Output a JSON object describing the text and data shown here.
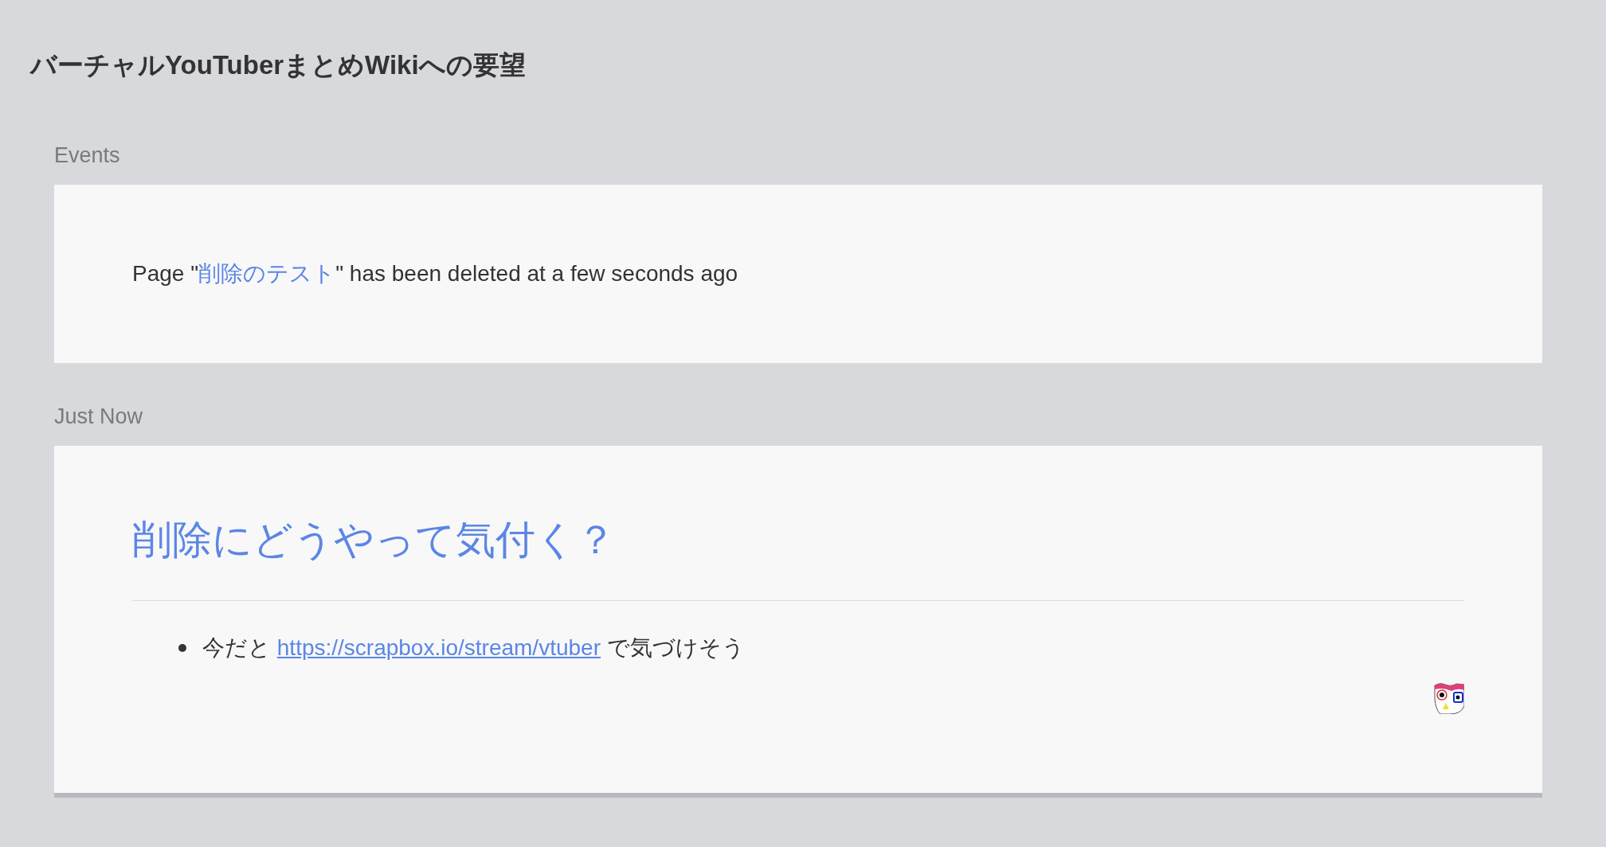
{
  "title": "バーチャルYouTuberまとめWikiへの要望",
  "sections": [
    {
      "heading": "Events",
      "card": {
        "kind": "event",
        "before": "Page \"",
        "link": "削除のテスト",
        "after": "\" has been deleted at a few seconds ago"
      }
    },
    {
      "heading": "Just Now",
      "card": {
        "kind": "page",
        "title": "削除にどうやって気付く？",
        "bullets": [
          {
            "before": "今だと ",
            "link": "https://scrapbox.io/stream/vtuber",
            "after": " で気づけそう"
          }
        ]
      }
    }
  ]
}
